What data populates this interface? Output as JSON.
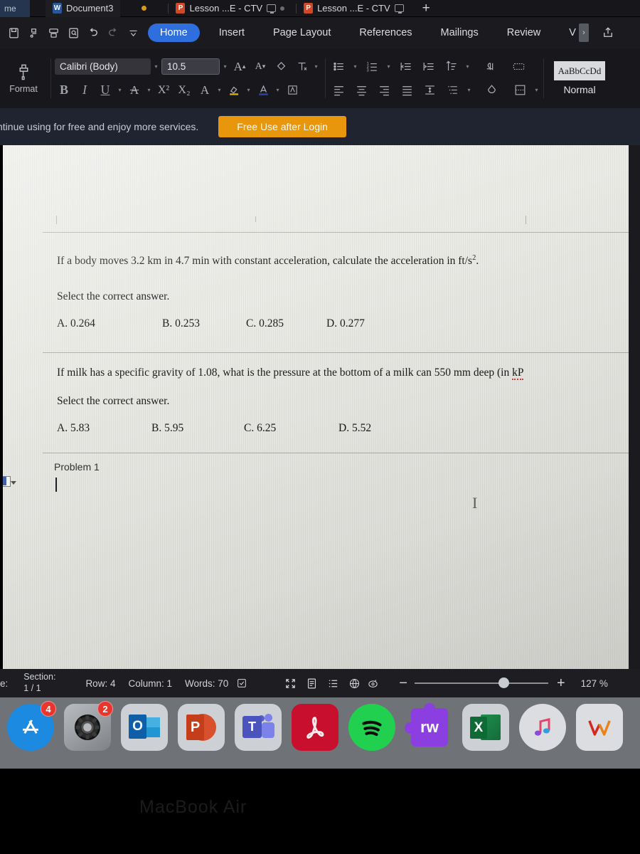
{
  "window": {
    "tabs": [
      {
        "label": "me",
        "icon": "clipped-tab",
        "app": ""
      },
      {
        "label": "Document3",
        "icon": "word-icon",
        "app": "W",
        "active": true,
        "dot": "unsaved-dot"
      },
      {
        "label": "Lesson ...E - CTV",
        "icon": "powerpoint-icon",
        "app": "P",
        "screen": true,
        "dot": "grey-dot"
      },
      {
        "label": "Lesson ...E - CTV",
        "icon": "powerpoint-icon",
        "app": "P",
        "screen": true
      }
    ],
    "new_tab_label": "+"
  },
  "ribbon": {
    "quick_access": [
      "save-icon",
      "print-preview-icon",
      "print-icon",
      "find-icon",
      "undo-icon",
      "redo-icon",
      "customize-icon"
    ],
    "tabs": [
      {
        "label": "Home",
        "active": true
      },
      {
        "label": "Insert",
        "active": false
      },
      {
        "label": "Page Layout",
        "active": false
      },
      {
        "label": "References",
        "active": false
      },
      {
        "label": "Mailings",
        "active": false
      },
      {
        "label": "Review",
        "active": false
      },
      {
        "label": "V",
        "active": false
      }
    ],
    "overflow_label": "›",
    "share_icon": "share-icon",
    "format_label": "Format",
    "font": {
      "name": "Calibri (Body)",
      "size": "10.5",
      "grow_label": "A",
      "shrink_label": "A",
      "clear_format_icon": "clear-formatting-icon",
      "text_effects_icon": "text-effects-icon",
      "bold_label": "B",
      "italic_label": "I",
      "underline_label": "U",
      "strikethrough_label": "A",
      "superscript_label": "X²",
      "subscript_label": "X₂",
      "char_border_label": "A",
      "highlight_icon": "highlight-color-icon",
      "font_color_icon": "font-color-icon",
      "char_shading_icon": "character-shading-icon"
    },
    "paragraph": {
      "bullets_icon": "bullet-list-icon",
      "numbering_icon": "numbered-list-icon",
      "decrease_indent_icon": "decrease-indent-icon",
      "increase_indent_icon": "increase-indent-icon",
      "sort_icon": "sort-icon",
      "show_marks_icon": "show-formatting-marks-icon",
      "arabic_icon": "arabic-text-icon",
      "align_left_icon": "align-left-icon",
      "align_center_icon": "align-center-icon",
      "align_right_icon": "align-right-icon",
      "justify_icon": "justify-icon",
      "line_spacing_icon": "line-spacing-icon",
      "multilevel_icon": "multilevel-list-icon",
      "shading_icon": "paragraph-shading-icon",
      "borders_icon": "borders-icon"
    },
    "styles": {
      "preview_text": "AaBbCcDd",
      "name": "Normal"
    }
  },
  "banner": {
    "message": "ntinue using for free and enjoy more services.",
    "cta_label": "Free Use after Login",
    "cta_color": "#e8960c"
  },
  "document": {
    "question1": {
      "stem_pre": "If a body moves 3.2 km in 4.7 min with constant acceleration, calculate the acceleration in ft/s",
      "stem_sup": "2",
      "stem_post": ".",
      "prompt": "Select the correct answer.",
      "options": [
        "A. 0.264",
        "B. 0.253",
        "C. 0.285",
        "D. 0.277"
      ]
    },
    "question2": {
      "stem_pre": "If milk has a specific gravity of 1.08, what is the pressure at the bottom of a milk can 550 mm deep (in ",
      "stem_clipped": "kP",
      "prompt": "Select the correct answer.",
      "options": [
        "A. 5.83",
        "B. 5.95",
        "C. 6.25",
        "D. 5.52"
      ]
    },
    "problem_heading": "Problem 1",
    "cursor": "text-caret"
  },
  "status": {
    "page_label": "e:",
    "section_label": "Section:",
    "section_value": "1 / 1",
    "row": "Row: 4",
    "column": "Column: 1",
    "words": "Words: 70",
    "proofing_icon": "proofing-check-icon",
    "view_icons": [
      "focus-mode-icon",
      "print-layout-icon",
      "outline-view-icon",
      "web-layout-icon",
      "immersive-reader-icon"
    ],
    "zoom_out_label": "−",
    "zoom_in_label": "+",
    "zoom_value": "127 %"
  },
  "dock": {
    "items": [
      {
        "name": "app-store",
        "label": "",
        "badge": "4",
        "shape": "circle",
        "color": "#1c8ae0"
      },
      {
        "name": "system-preferences",
        "label": "",
        "badge": "2",
        "shape": "square",
        "color": "#8a8d90"
      },
      {
        "name": "outlook",
        "label": "O",
        "badge": "",
        "shape": "square",
        "color": "#cfd2d6"
      },
      {
        "name": "powerpoint",
        "label": "P",
        "badge": "",
        "shape": "square",
        "color": "#cfd2d6"
      },
      {
        "name": "teams",
        "label": "T",
        "badge": "",
        "shape": "square",
        "color": "#cfd2d6"
      },
      {
        "name": "adobe-acrobat",
        "label": "",
        "badge": "",
        "shape": "square",
        "color": "#c8102e"
      },
      {
        "name": "spotify",
        "label": "",
        "badge": "",
        "shape": "circle",
        "color": "#22d04f"
      },
      {
        "name": "read-write",
        "label": "rw",
        "badge": "",
        "shape": "puzzle",
        "color": "#8b3fe0"
      },
      {
        "name": "excel",
        "label": "X",
        "badge": "",
        "shape": "square",
        "color": "#cfd2d6"
      },
      {
        "name": "music",
        "label": "",
        "badge": "",
        "shape": "circle",
        "color": "#dcdde1"
      },
      {
        "name": "wps-office",
        "label": "W",
        "badge": "",
        "shape": "square",
        "color": "#dcdde1"
      }
    ]
  },
  "laptop": {
    "bezel_text": "MacBook Air"
  }
}
